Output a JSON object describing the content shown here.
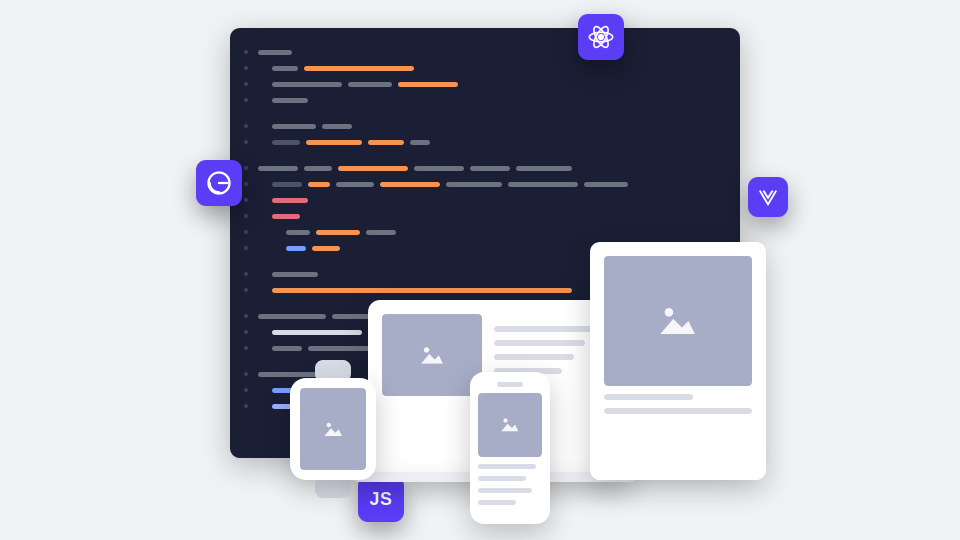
{
  "badges": {
    "react": {
      "name": "react-icon",
      "label": ""
    },
    "gatsby": {
      "name": "gatsby-icon",
      "label": ""
    },
    "vue": {
      "name": "vue-icon",
      "label": ""
    },
    "js": {
      "name": "javascript-icon",
      "label": "JS"
    }
  },
  "colors": {
    "badge_bg": "#5b3df5",
    "editor_bg": "#1a1f36",
    "code_orange": "#f59350",
    "code_gray": "#6b7280",
    "code_blue": "#7b9cff",
    "code_red": "#e36b7a",
    "placeholder_gray": "#a7adc7"
  },
  "devices": {
    "laptop": "laptop-device",
    "tablet": "tablet-device",
    "phone": "phone-device",
    "watch": "watch-device"
  }
}
